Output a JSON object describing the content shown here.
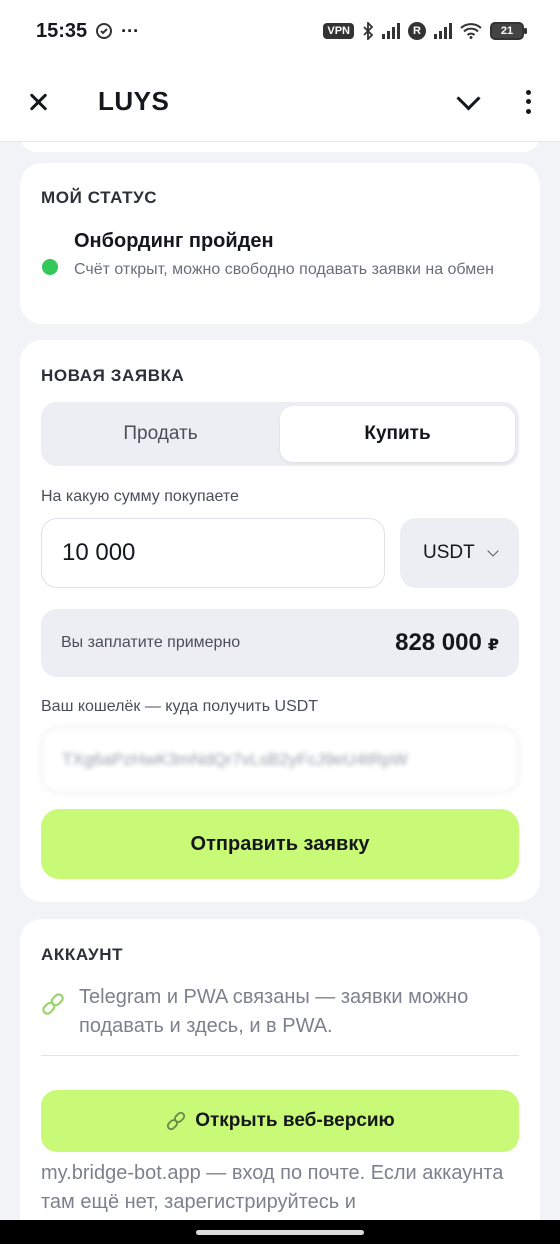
{
  "status_bar": {
    "time": "15:35",
    "vpn": "VPN",
    "carrier_badge": "R",
    "battery": "21"
  },
  "app_bar": {
    "title": "LUYS",
    "icons": [
      "close-icon",
      "chevron-down-icon",
      "more-vert-icon"
    ]
  },
  "my_status": {
    "heading": "МОЙ СТАТУС",
    "title": "Онбординг пройден",
    "description": "Счёт открыт, можно свободно подавать заявки на обмен",
    "indicator_color": "#34c759"
  },
  "new_order": {
    "heading": "НОВАЯ ЗАЯВКА",
    "tabs": [
      {
        "label": "Продать",
        "selected": false
      },
      {
        "label": "Купить",
        "selected": true
      }
    ],
    "amount_label": "На какую сумму покупаете",
    "amount_value": "10 000",
    "currency": "USDT",
    "estimate_label": "Вы заплатите примерно",
    "estimate_value": "828 000",
    "estimate_currency": "₽",
    "wallet_label": "Ваш кошелёк — куда получить USDT",
    "wallet_value": "TXg6aPzHwK3mNdQr7vLsB2yFcJ9eU4tRpW",
    "submit_label": "Отправить заявку"
  },
  "account": {
    "heading": "АККАУНТ",
    "description": "Telegram и PWA связаны — заявки можно подавать и здесь, и в PWA.",
    "open_web_label": "Открыть веб-версию",
    "footer_note": "my.bridge-bot.app — вход по почте. Если аккаунта там ещё нет, зарегистрируйтесь и"
  },
  "colors": {
    "accent": "#c8fa78",
    "background": "#f2f3f7",
    "card": "#ffffff",
    "success": "#34c759"
  }
}
